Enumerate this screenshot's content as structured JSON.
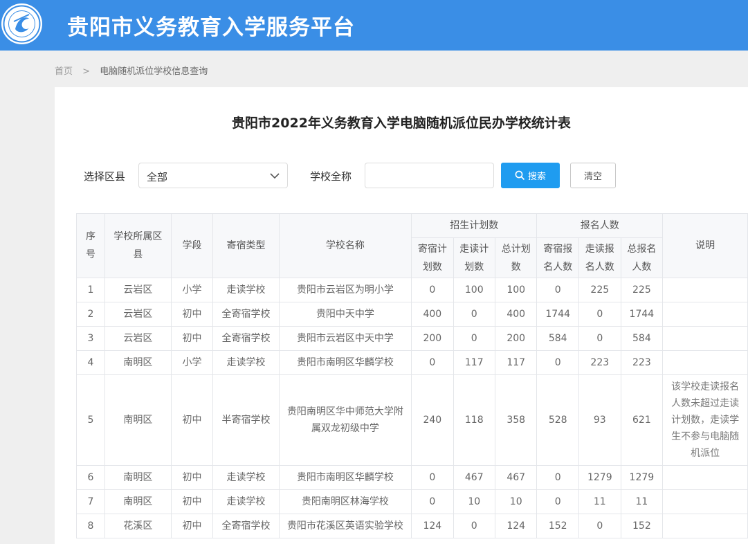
{
  "header": {
    "title": "贵阳市义务教育入学服务平台",
    "logo_icon": "education-logo-icon",
    "bg_color": "#3a8ee6"
  },
  "breadcrumb": {
    "home": "首页",
    "separator": ">",
    "current": "电脑随机派位学校信息查询"
  },
  "page_title": "贵阳市2022年义务教育入学电脑随机派位民办学校统计表",
  "filters": {
    "district_label": "选择区县",
    "district_value": "全部",
    "school_label": "学校全称",
    "school_value": "",
    "school_placeholder": "",
    "search_label": "搜索",
    "clear_label": "清空",
    "search_color": "#1f9cf0"
  },
  "table": {
    "headers": {
      "index": "序号",
      "district": "学校所属区县",
      "stage": "学段",
      "boarding": "寄宿类型",
      "school": "学校名称",
      "plan_group": "招生计划数",
      "signup_group": "报名人数",
      "note": "说明",
      "plan_board": "寄宿计划数",
      "plan_day": "走读计划数",
      "plan_total": "总计划数",
      "sign_board": "寄宿报名人数",
      "sign_day": "走读报名人数",
      "sign_total": "总报名人数"
    },
    "rows": [
      {
        "index": "1",
        "district": "云岩区",
        "stage": "小学",
        "boarding": "走读学校",
        "school": "贵阳市云岩区为明小学",
        "plan_board": "0",
        "plan_day": "100",
        "plan_total": "100",
        "sign_board": "0",
        "sign_day": "225",
        "sign_total": "225",
        "note": ""
      },
      {
        "index": "2",
        "district": "云岩区",
        "stage": "初中",
        "boarding": "全寄宿学校",
        "school": "贵阳中天中学",
        "plan_board": "400",
        "plan_day": "0",
        "plan_total": "400",
        "sign_board": "1744",
        "sign_day": "0",
        "sign_total": "1744",
        "note": ""
      },
      {
        "index": "3",
        "district": "云岩区",
        "stage": "初中",
        "boarding": "全寄宿学校",
        "school": "贵阳市云岩区中天中学",
        "plan_board": "200",
        "plan_day": "0",
        "plan_total": "200",
        "sign_board": "584",
        "sign_day": "0",
        "sign_total": "584",
        "note": ""
      },
      {
        "index": "4",
        "district": "南明区",
        "stage": "小学",
        "boarding": "走读学校",
        "school": "贵阳市南明区华麟学校",
        "plan_board": "0",
        "plan_day": "117",
        "plan_total": "117",
        "sign_board": "0",
        "sign_day": "223",
        "sign_total": "223",
        "note": ""
      },
      {
        "index": "5",
        "district": "南明区",
        "stage": "初中",
        "boarding": "半寄宿学校",
        "school": "贵阳南明区华中师范大学附属双龙初级中学",
        "plan_board": "240",
        "plan_day": "118",
        "plan_total": "358",
        "sign_board": "528",
        "sign_day": "93",
        "sign_total": "621",
        "note": "该学校走读报名人数未超过走读计划数，走读学生不参与电脑随机派位"
      },
      {
        "index": "6",
        "district": "南明区",
        "stage": "初中",
        "boarding": "走读学校",
        "school": "贵阳市南明区华麟学校",
        "plan_board": "0",
        "plan_day": "467",
        "plan_total": "467",
        "sign_board": "0",
        "sign_day": "1279",
        "sign_total": "1279",
        "note": ""
      },
      {
        "index": "7",
        "district": "南明区",
        "stage": "初中",
        "boarding": "走读学校",
        "school": "贵阳南明区林海学校",
        "plan_board": "0",
        "plan_day": "10",
        "plan_total": "10",
        "sign_board": "0",
        "sign_day": "11",
        "sign_total": "11",
        "note": ""
      },
      {
        "index": "8",
        "district": "花溪区",
        "stage": "初中",
        "boarding": "全寄宿学校",
        "school": "贵阳市花溪区英语实验学校",
        "plan_board": "124",
        "plan_day": "0",
        "plan_total": "124",
        "sign_board": "152",
        "sign_day": "0",
        "sign_total": "152",
        "note": ""
      }
    ]
  }
}
